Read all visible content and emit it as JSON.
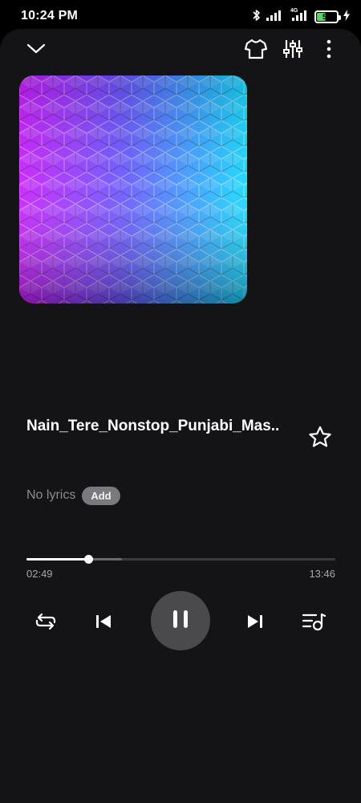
{
  "status_bar": {
    "time": "10:24 PM",
    "battery_level": "51",
    "battery_fraction": 0.51,
    "network": "4G",
    "icons": [
      "bluetooth-icon",
      "signal-icon",
      "signal-4g-icon",
      "battery-icon",
      "charging-icon"
    ]
  },
  "top_bar": {
    "icons": [
      "chevron-down-icon",
      "tshirt-icon",
      "equalizer-icon",
      "more-vert-icon"
    ]
  },
  "track": {
    "title": "Nain_Tere_Nonstop_Punjabi_Mas..",
    "favorite_icon": "star-outline-icon"
  },
  "lyrics": {
    "label": "No lyrics",
    "add_label": "Add"
  },
  "playback": {
    "elapsed": "02:49",
    "total": "13:46",
    "progress_fraction": 0.2,
    "buffered_fraction": 0.31,
    "state": "playing"
  },
  "controls": {
    "icons": [
      "repeat-icon",
      "previous-icon",
      "pause-icon",
      "next-icon",
      "queue-icon"
    ]
  },
  "colors": {
    "background": "#141416",
    "accent": "#ffffff",
    "play_button": "#4a4a4d",
    "art_left": "#c21cff",
    "art_right": "#18d4ff"
  }
}
